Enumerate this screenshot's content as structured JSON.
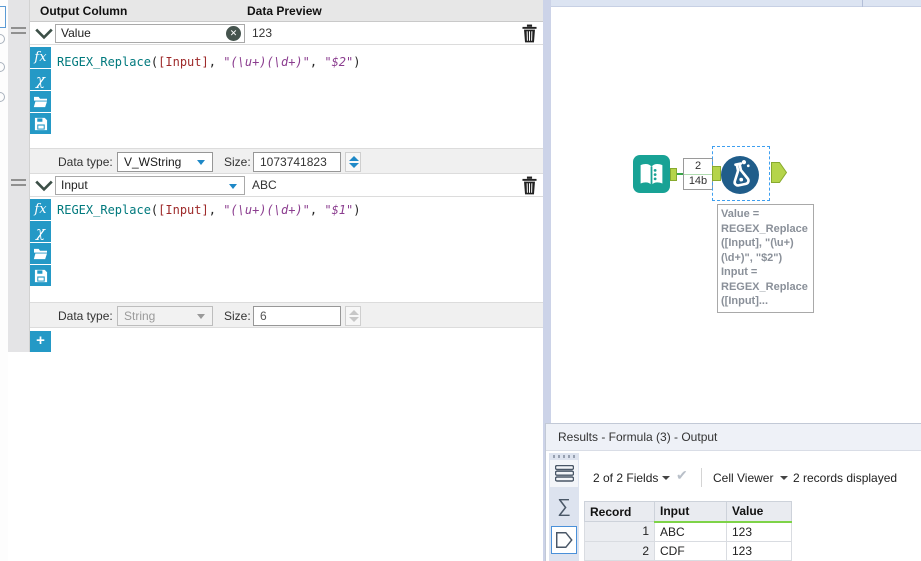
{
  "config_panel": {
    "column_headers": {
      "output_column": "Output Column",
      "data_preview": "Data Preview"
    },
    "expressions": [
      {
        "output_column": "Value",
        "data_preview": "123",
        "formula_segments": [
          {
            "t": "REGEX_Replace",
            "c": "fn"
          },
          {
            "t": "(",
            "c": "p"
          },
          {
            "t": "[Input]",
            "c": "fld"
          },
          {
            "t": ", ",
            "c": "p"
          },
          {
            "t": "\"(\\u+)(\\d+)\"",
            "c": "str"
          },
          {
            "t": ", ",
            "c": "p"
          },
          {
            "t": "\"$2\"",
            "c": "str"
          },
          {
            "t": ")",
            "c": "p"
          }
        ],
        "data_type_label": "Data type:",
        "data_type": "V_WString",
        "size_label": "Size:",
        "size": "1073741823"
      },
      {
        "output_column": "Input",
        "data_preview": "ABC",
        "formula_segments": [
          {
            "t": "REGEX_Replace",
            "c": "fn"
          },
          {
            "t": "(",
            "c": "p"
          },
          {
            "t": "[Input]",
            "c": "fld"
          },
          {
            "t": ", ",
            "c": "p"
          },
          {
            "t": "\"(\\u+)(\\d+)\"",
            "c": "str"
          },
          {
            "t": ", ",
            "c": "p"
          },
          {
            "t": "\"$1\"",
            "c": "str"
          },
          {
            "t": ")",
            "c": "p"
          }
        ],
        "data_type_label": "Data type:",
        "data_type": "String",
        "size_label": "Size:",
        "size": "6"
      }
    ],
    "editor_icons": {
      "insert_function": "fx",
      "insert_variable": "χ"
    },
    "clear_glyph": "✕",
    "add_expression": "+"
  },
  "canvas": {
    "connection_badge": {
      "top": "2",
      "bottom": "14b"
    },
    "tool_annotation_lines": [
      "Value =",
      "REGEX_Replace",
      "([Input], \"(\\u+)",
      "(\\d+)\", \"$2\")",
      "Input =",
      "REGEX_Replace",
      "([Input]..."
    ]
  },
  "results_panel": {
    "title": "Results - Formula (3) - Output",
    "toolbar": {
      "fields_summary": "2 of 2 Fields",
      "check_glyph": "✔",
      "cell_viewer_label": "Cell Viewer",
      "records_summary": "2 records displayed"
    },
    "sigma_glyph": "∑",
    "table": {
      "columns": [
        "Record",
        "Input",
        "Value"
      ],
      "rows": [
        [
          "1",
          "ABC",
          "123"
        ],
        [
          "2",
          "CDF",
          "123"
        ]
      ]
    }
  },
  "colors": {
    "accent_blue": "#2499c6",
    "formula_tool_blue": "#205d8a",
    "text_input_teal": "#18a295",
    "anchor_green": "#b5d44a",
    "connector_green": "#3aa648",
    "header_underline_green": "#7ed348",
    "selection_dash_blue": "#3e9ff0"
  }
}
